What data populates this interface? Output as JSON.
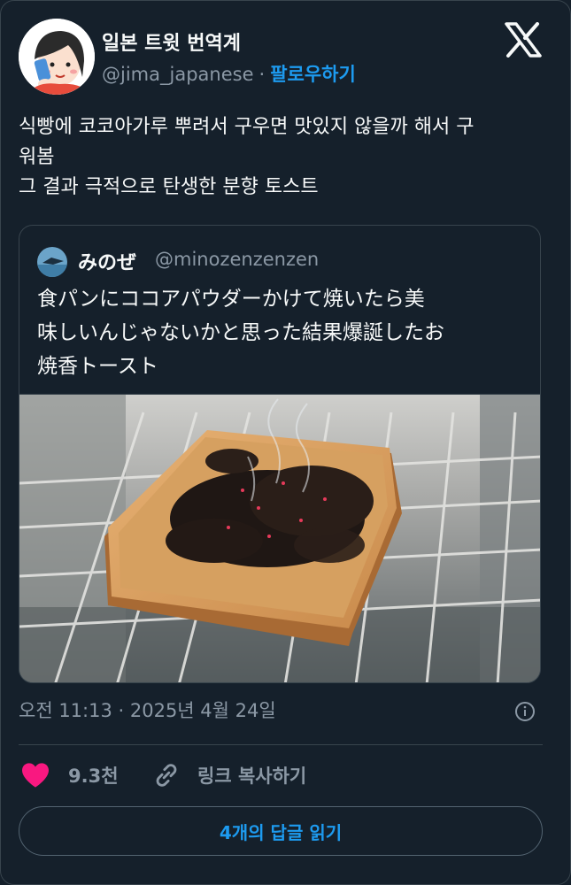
{
  "author": {
    "display_name": "일본 트윗 번역계",
    "handle": "@jima_japanese",
    "separator": "·",
    "follow_label": "팔로우하기"
  },
  "tweet": {
    "lines": [
      "식빵에 코코아가루 뿌려서 구우면 맛있지 않을까 해서 구",
      "워봄",
      "그 결과 극적으로 탄생한 분향 토스트"
    ]
  },
  "quoted": {
    "display_name": "みのぜ",
    "handle": "@minozenzenzen",
    "lines": [
      "食パンにココアパウダーかけて焼いたら美",
      "味しいんじゃないかと思った結果爆誕したお",
      "焼香トースト"
    ]
  },
  "meta": {
    "timestamp": "오전 11:13 · 2025년 4월 24일"
  },
  "actions": {
    "like_count": "9.3천",
    "copy_link_label": "링크 복사하기",
    "read_replies_label": "4개의 답글 읽기"
  },
  "colors": {
    "background": "#15202b",
    "accent": "#1d9bf0",
    "like": "#f91880",
    "secondary_text": "#8b98a5",
    "border": "#38444d"
  },
  "icons": [
    "x-logo-icon",
    "info-icon",
    "heart-icon",
    "link-icon"
  ]
}
